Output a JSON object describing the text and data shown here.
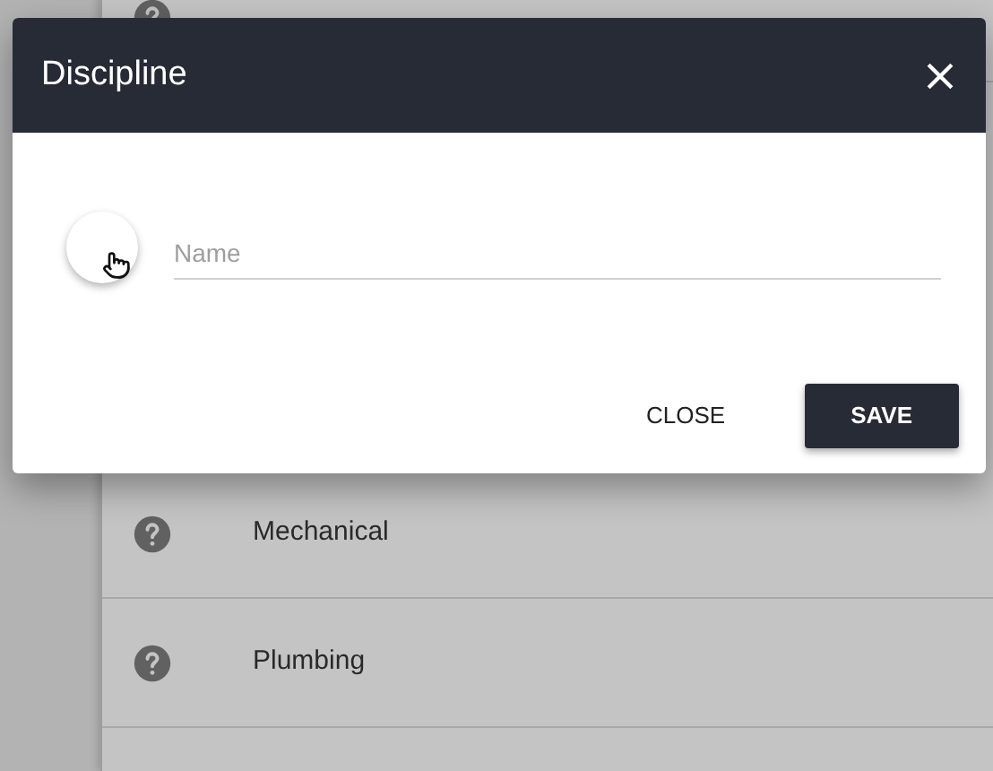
{
  "list": {
    "items": [
      {
        "label": "Mechanical",
        "kind": "row"
      },
      {
        "label": "Plumbing",
        "kind": "row"
      }
    ]
  },
  "dialog": {
    "title": "Discipline",
    "name_field": {
      "placeholder": "Name"
    },
    "buttons": [
      {
        "label": "CLOSE",
        "kind": "text"
      },
      {
        "label": "SAVE",
        "kind": "primary"
      }
    ]
  }
}
